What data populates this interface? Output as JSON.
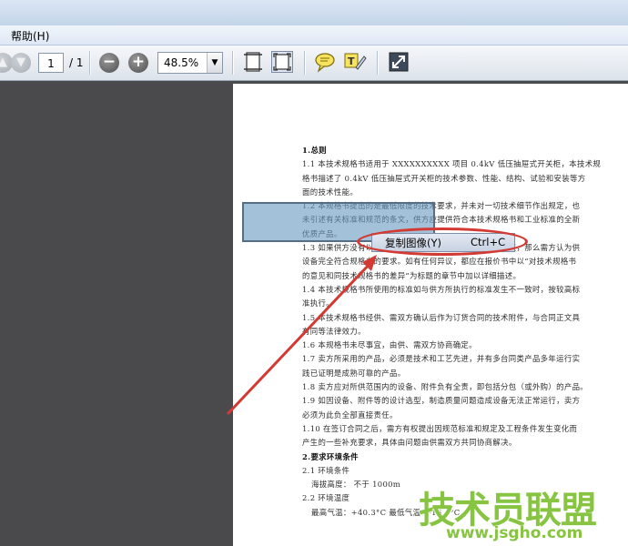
{
  "menubar": {
    "help_label": "帮助(H)"
  },
  "toolbar": {
    "page_current": "1",
    "page_total": "/ 1",
    "zoom_value": "48.5%"
  },
  "document": {
    "lines": [
      {
        "text": "1.总则",
        "style": "h"
      },
      {
        "text": "1.1 本技术规格书适用于 XXXXXXXXXX 项目 0.4kV 低压抽屉式开关柜，本技术规",
        "style": ""
      },
      {
        "text": "格书描述了 0.4kV 低压抽屉式开关柜的技术参数、性能、结构、试验和安装等方",
        "style": ""
      },
      {
        "text": "面的技术性能。",
        "style": ""
      },
      {
        "text": "1.2 本规格书提出的是最低限度的技术要求，并未对一切技术细节作出规定，也",
        "style": ""
      },
      {
        "text": "未引述有关标准和规范的条文，供方应提供符合本技术规格书和工业标准的全新",
        "style": ""
      },
      {
        "text": "优质产品。",
        "style": ""
      },
      {
        "text": "1.3 如果供方没有以书面形式对本技术规格书的条文提出异议，那么需方认为供",
        "style": ""
      },
      {
        "text": "设备完全符合规格书的要求。如有任何异议，都应在报价书中以“对技术规格书",
        "style": ""
      },
      {
        "text": "的意见和同技术规格书的差异”为标题的章节中加以详细描述。",
        "style": ""
      },
      {
        "text": "1.4 本技术规格书所使用的标准如与供方所执行的标准发生不一致时，按较高标",
        "style": ""
      },
      {
        "text": "准执行。",
        "style": ""
      },
      {
        "text": "1.5 本技术规格书经供、需双方确认后作为订货合同的技术附件，与合同正文具",
        "style": ""
      },
      {
        "text": "有同等法律效力。",
        "style": ""
      },
      {
        "text": "1.6 本规格书未尽事宜，由供、需双方协商确定。",
        "style": ""
      },
      {
        "text": "1.7 卖方所采用的产品，必须是技术和工艺先进，并有多台同类产品多年运行实",
        "style": ""
      },
      {
        "text": "践已证明是成熟可靠的产品。",
        "style": ""
      },
      {
        "text": "1.8 卖方应对所供范围内的设备、附件负有全责，即包括分包（或外购）的产品。",
        "style": ""
      },
      {
        "text": "1.9 如因设备、附件等的设计选型，制造质量问题造成设备无法正常运行，卖方",
        "style": ""
      },
      {
        "text": "必须为此负全部直接责任。",
        "style": ""
      },
      {
        "text": "1.10 在签订合同之后，需方有权提出因规范标准和规定及工程条件发生变化而",
        "style": ""
      },
      {
        "text": "产生的一些补充要求，具体由问题由供需双方共同协商解决。",
        "style": ""
      },
      {
        "text": "2.要求环境条件",
        "style": "h"
      },
      {
        "text": "2.1 环境条件",
        "style": ""
      },
      {
        "text": "海拔高度：        不于 1000m",
        "style": "ind"
      },
      {
        "text": "2.2 环境温度",
        "style": ""
      },
      {
        "text": "最高气温：+40.3°C              最低气温：-16.3°C",
        "style": "ind"
      }
    ]
  },
  "context_menu": {
    "item_label": "复制图像(Y)",
    "item_shortcut": "Ctrl+C"
  },
  "watermark": {
    "title": "技术员联盟",
    "url": "www.jsgho.com"
  },
  "colors": {
    "highlight_oval": "#d33a33",
    "watermark_green": "#86c441",
    "selection": "#6c9bc4"
  }
}
